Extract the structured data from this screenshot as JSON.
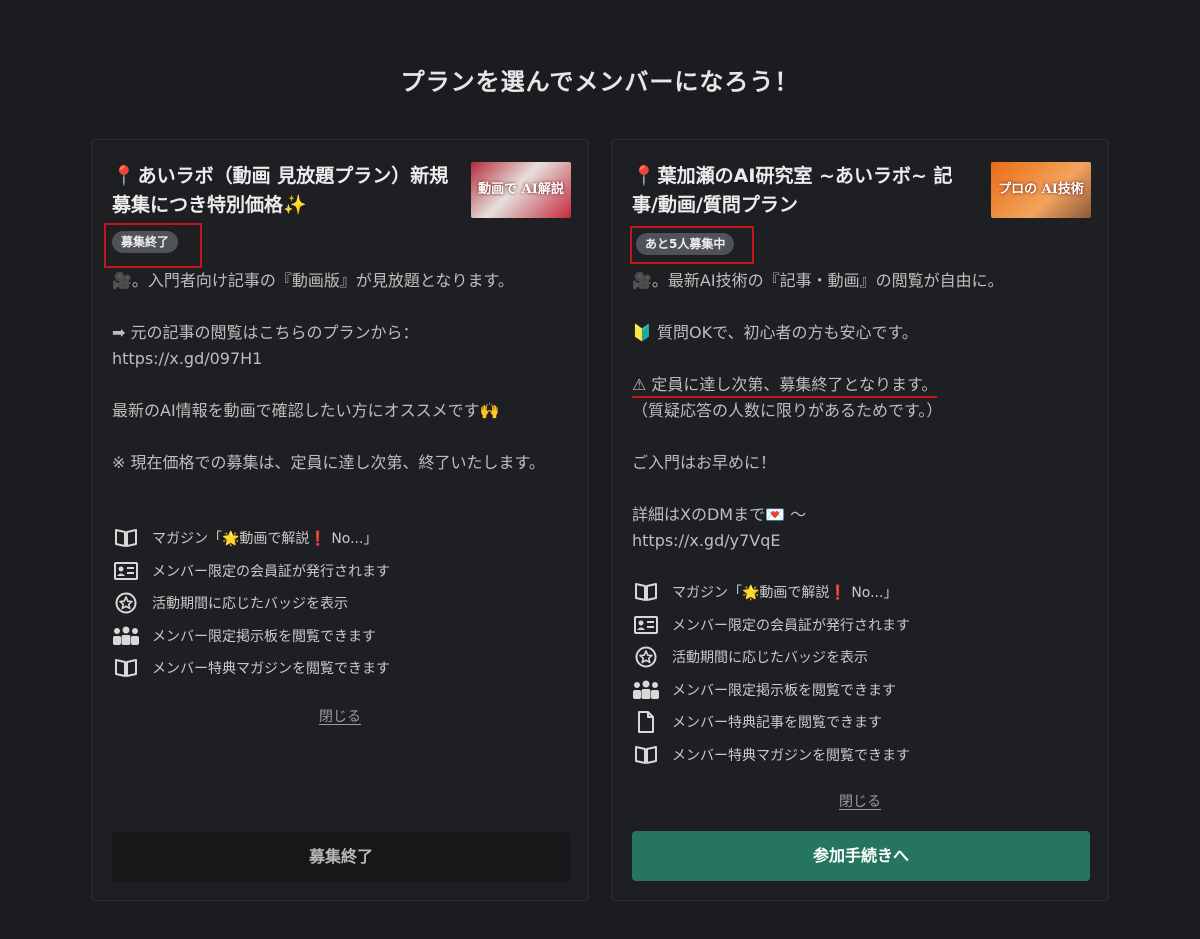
{
  "page": {
    "title": "プランを選んでメンバーになろう！"
  },
  "colors": {
    "accent": "#26755f",
    "highlight": "#c0161d",
    "background": "#1b1c1f"
  },
  "plans": [
    {
      "name": "あいラボ（動画 見放題プラン）新規募集につき特別価格✨",
      "thumb_text": "動画で AI解説",
      "badge": "募集終了",
      "desc_lines": [
        "🎥。入門者向け記事の『動画版』が見放題となります。",
        "",
        "➡ 元の記事の閲覧はこちらのプランから：",
        "https://x.gd/097H1",
        "",
        "最新のAI情報を動画で確認したい方にオススメです🙌",
        "",
        "※ 現在価格での募集は、定員に達し次第、終了いたします。"
      ],
      "benefits": [
        {
          "icon": "book-icon",
          "label": "マガジン「🌟動画で解説❗ No...」"
        },
        {
          "icon": "id-card-icon",
          "label": "メンバー限定の会員証が発行されます"
        },
        {
          "icon": "badge-star-icon",
          "label": "活動期間に応じたバッジを表示"
        },
        {
          "icon": "people-icon",
          "label": "メンバー限定掲示板を閲覧できます"
        },
        {
          "icon": "book-icon",
          "label": "メンバー特典マガジンを閲覧できます"
        }
      ],
      "close_label": "閉じる",
      "cta_label": "募集終了"
    },
    {
      "name": "葉加瀬のAI研究室 ~あいラボ~ 記事/動画/質問プラン",
      "thumb_text": "プロの AI技術",
      "badge": "あと5人募集中",
      "desc_lines": [
        "🎥。最新AI技術の『記事・動画』の閲覧が自由に。",
        "",
        "🔰 質問OKで、初心者の方も安心です。",
        "",
        "⚠ 定員に達し次第、募集終了となります。",
        "（質疑応答の人数に限りがあるためです。）",
        "",
        "ご入門はお早めに！",
        "",
        "詳細はXのDMまで💌 ～",
        "https://x.gd/y7VqE"
      ],
      "benefits": [
        {
          "icon": "book-icon",
          "label": "マガジン「🌟動画で解説❗ No...」"
        },
        {
          "icon": "id-card-icon",
          "label": "メンバー限定の会員証が発行されます"
        },
        {
          "icon": "badge-star-icon",
          "label": "活動期間に応じたバッジを表示"
        },
        {
          "icon": "people-icon",
          "label": "メンバー限定掲示板を閲覧できます"
        },
        {
          "icon": "document-icon",
          "label": "メンバー特典記事を閲覧できます"
        },
        {
          "icon": "book-icon",
          "label": "メンバー特典マガジンを閲覧できます"
        }
      ],
      "close_label": "閉じる",
      "cta_label": "参加手続きへ"
    }
  ]
}
